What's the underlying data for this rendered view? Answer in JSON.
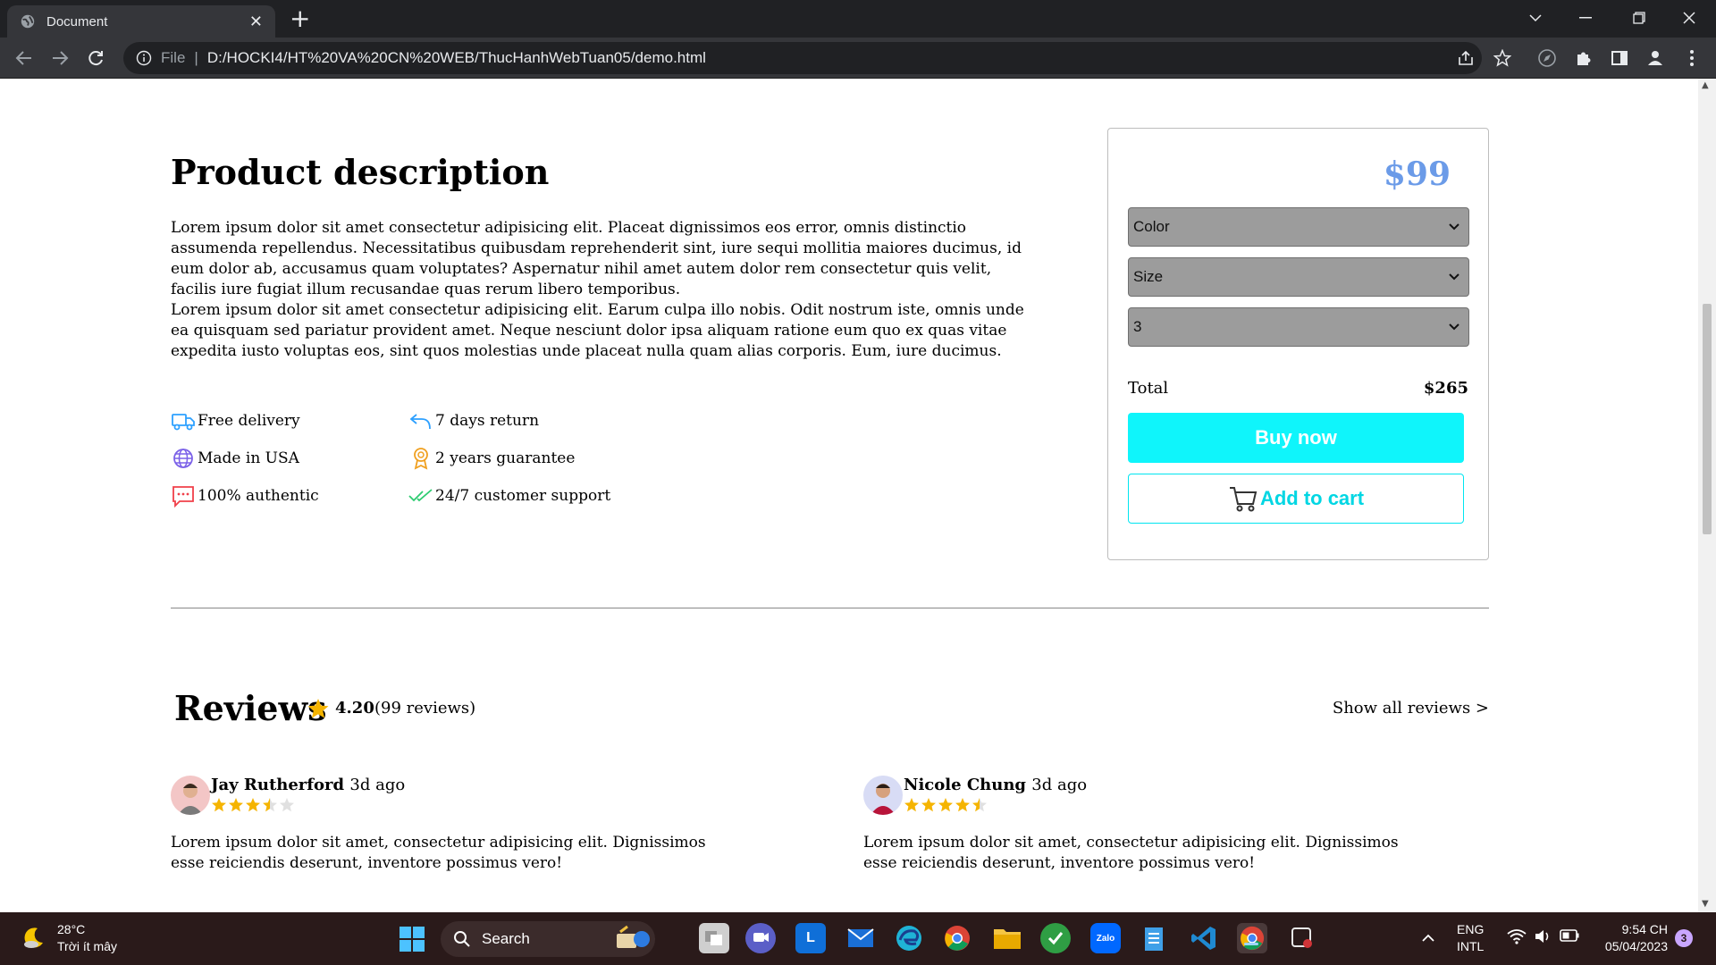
{
  "browser": {
    "tab_title": "Document",
    "new_tab": "+",
    "url_scheme_label": "File",
    "url_separator": "|",
    "url": "D:/HOCKI4/HT%20VA%20CN%20WEB/ThucHanhWebTuan05/demo.html"
  },
  "product": {
    "title": "Product description",
    "paragraphs": [
      "Lorem ipsum dolor sit amet consectetur adipisicing elit. Placeat dignissimos eos error, omnis distinctio assumenda repellendus. Necessitatibus quibusdam reprehenderit sint, iure sequi mollitia maiores ducimus, id eum dolor ab, accusamus quam voluptates? Aspernatur nihil amet autem dolor rem consectetur quis velit, facilis iure fugiat illum recusandae quas rerum libero temporibus.",
      "Lorem ipsum dolor sit amet consectetur adipisicing elit. Earum culpa illo nobis. Odit nostrum iste, omnis unde ea quisquam sed pariatur provident amet. Neque nesciunt dolor ipsa aliquam ratione eum quo ex quas vitae expedita iusto voluptas eos, sint quos molestias unde placeat nulla quam alias corporis. Eum, iure ducimus."
    ],
    "features": [
      {
        "label": "Free delivery",
        "icon": "truck-icon"
      },
      {
        "label": "7 days return",
        "icon": "return-arrow-icon"
      },
      {
        "label": "Made in USA",
        "icon": "globe-icon"
      },
      {
        "label": "2 years guarantee",
        "icon": "award-icon"
      },
      {
        "label": "100% authentic",
        "icon": "chat-icon"
      },
      {
        "label": "24/7 customer support",
        "icon": "double-check-icon"
      }
    ]
  },
  "order": {
    "price": "$99",
    "color_select": "Color",
    "size_select": "Size",
    "quantity_select": "3",
    "total_label": "Total",
    "total_value": "$265",
    "buy_label": "Buy now",
    "cart_label": "Add to cart",
    "accent_color": "#0ff5fb",
    "price_color": "#6b9be8"
  },
  "reviews": {
    "title": "Reviews",
    "rating": "4.20",
    "count": "(99 reviews)",
    "show_all": "Show all reviews >",
    "items": [
      {
        "name": "Jay Rutherford",
        "time": "3d ago",
        "stars": 3.5,
        "text": "Lorem ipsum dolor sit amet, consectetur adipisicing elit. Dignissimos esse reiciendis deserunt, inventore possimus vero!"
      },
      {
        "name": "Nicole Chung",
        "time": "3d ago",
        "stars": 4.5,
        "text": "Lorem ipsum dolor sit amet, consectetur adipisicing elit. Dignissimos esse reiciendis deserunt, inventore possimus vero!"
      }
    ]
  },
  "taskbar": {
    "temperature": "28°C",
    "weather": "Trời ít mây",
    "search_label": "Search",
    "language_line1": "ENG",
    "language_line2": "INTL",
    "time": "9:54 CH",
    "date": "05/04/2023",
    "notification_count": "3"
  }
}
